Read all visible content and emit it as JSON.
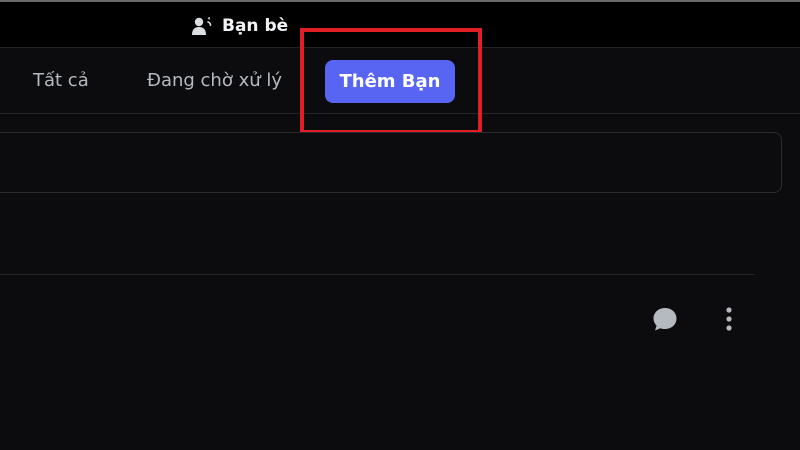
{
  "header": {
    "title": "Bạn bè",
    "title_icon": "person-wave-icon"
  },
  "tabs": [
    {
      "label": "Tất cả"
    },
    {
      "label": "Đang chờ xử lý"
    }
  ],
  "add_friend_button": {
    "label": "Thêm Bạn",
    "color": "#5865f2"
  },
  "highlight": {
    "color": "#e01f27"
  },
  "friend_row": {
    "actions": [
      {
        "icon": "message-bubble-icon"
      },
      {
        "icon": "more-vertical-icon"
      }
    ]
  }
}
